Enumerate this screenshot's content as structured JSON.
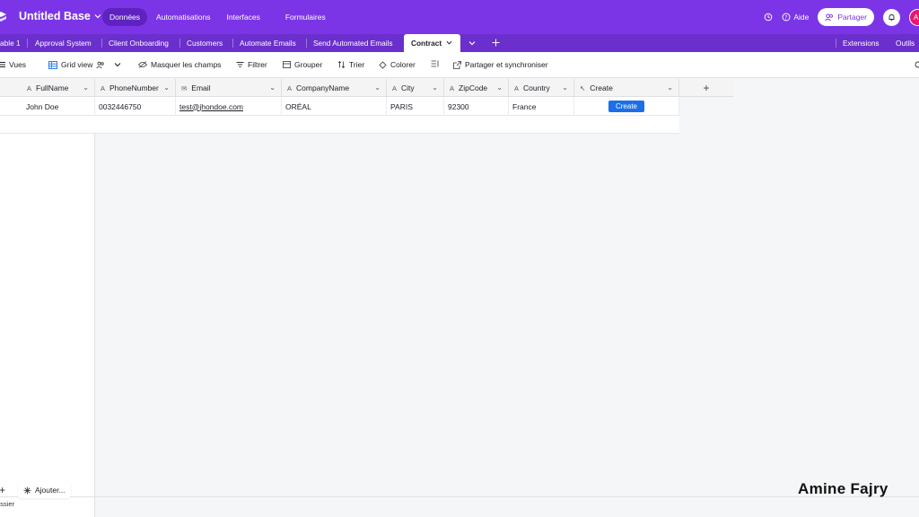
{
  "header": {
    "base_title": "Untitled Base",
    "nav": [
      "Données",
      "Automatisations",
      "Interfaces",
      "Formulaires"
    ],
    "help_label": "Aide",
    "share_label": "Partager",
    "avatar_initial": "A"
  },
  "tabs": {
    "items": [
      "able 1",
      "Approval System",
      "Client Onboarding",
      "Customers",
      "Automate Emails",
      "Send Automated Emails",
      "Contract"
    ],
    "active": "Contract",
    "extensions": "Extensions",
    "tools": "Outils"
  },
  "toolbar": {
    "views": "Vues",
    "grid_view": "Grid view",
    "hide_fields": "Masquer les champs",
    "filter": "Filtrer",
    "group": "Grouper",
    "sort": "Trier",
    "color": "Colorer",
    "share_sync": "Partager et synchroniser"
  },
  "table": {
    "columns": [
      "FullName",
      "PhoneNumber",
      "Email",
      "CompanyName",
      "City",
      "ZipCode",
      "Country",
      "Create"
    ],
    "rows": [
      {
        "fullname": "John Doe",
        "phone": "0032446750",
        "email": "test@jhondoe.com",
        "company": "ORÉAL",
        "city": "PARIS",
        "zip": "92300",
        "country": "France",
        "button": "Create"
      }
    ]
  },
  "bottom": {
    "add_label": "Ajouter...",
    "folder_label": "ossier"
  },
  "watermark": "Amine Fajry",
  "colors": {
    "topbar": "#7b35e6",
    "tabbar": "#6a2fcc",
    "create_button": "#1b6fe8",
    "avatar": "#e8186d"
  }
}
